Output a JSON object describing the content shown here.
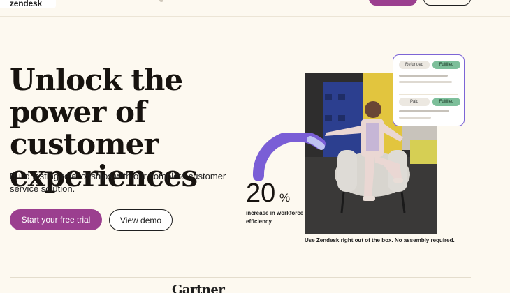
{
  "brand": {
    "logo_text": "zendesk"
  },
  "colors": {
    "accent": "#9b3f8f",
    "arc": "#7a5ed6",
    "fulfilled": "#7dbf9a",
    "background": "#fdf9f0"
  },
  "hero": {
    "headline": "Unlock the power of customer experiences",
    "subheadline": "Build lasting relationships with our complete customer service solution.",
    "primary_cta": "Start your free trial",
    "secondary_cta": "View demo"
  },
  "stat": {
    "number": "20",
    "unit": "%",
    "label": "increase in workforce efficiency"
  },
  "caption": "Use Zendesk right out of the box. No assembly required.",
  "status_card": {
    "rows": [
      {
        "status": "Refunded",
        "badge": "Fulfilled"
      },
      {
        "status": "Paid",
        "badge": "Fulfilled"
      }
    ]
  },
  "footer": {
    "logo_text": "Gartner"
  }
}
